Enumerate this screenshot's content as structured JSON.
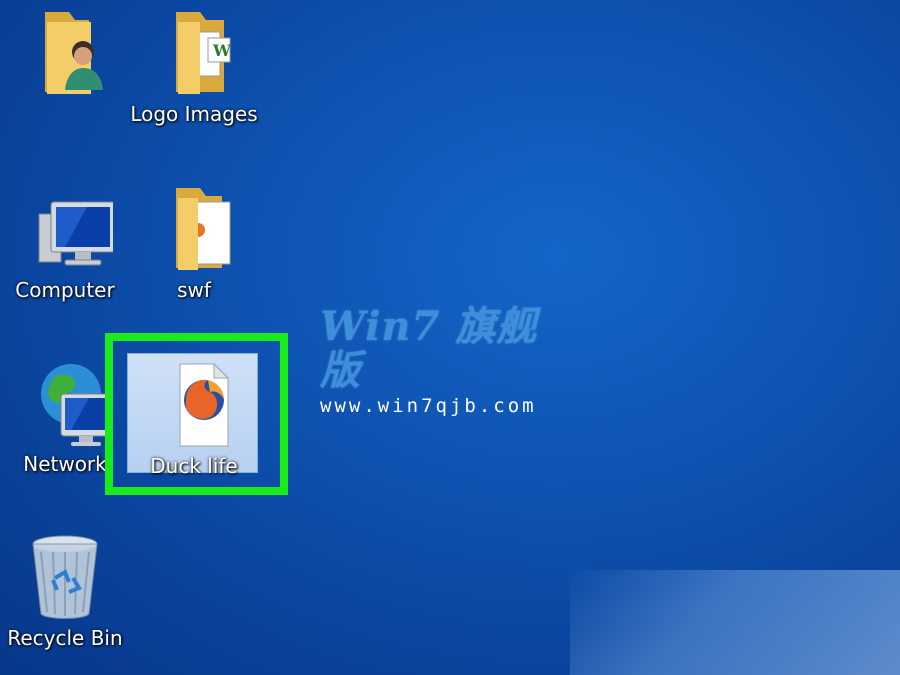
{
  "desktop": {
    "icons": [
      {
        "id": "user-folder",
        "label": ""
      },
      {
        "id": "logo-images",
        "label": "Logo Images"
      },
      {
        "id": "computer",
        "label": "Computer"
      },
      {
        "id": "swf",
        "label": "swf"
      },
      {
        "id": "network",
        "label": "Network"
      },
      {
        "id": "duck-life",
        "label": "Duck life"
      },
      {
        "id": "recycle-bin",
        "label": "Recycle Bin"
      }
    ],
    "watermark": {
      "logo": "Win7 旗舰版",
      "url": "www.win7qjb.com"
    }
  },
  "colors": {
    "highlight": "#1aeb1a",
    "desktop": "#0f55b4",
    "folder": "#f0c55a"
  }
}
